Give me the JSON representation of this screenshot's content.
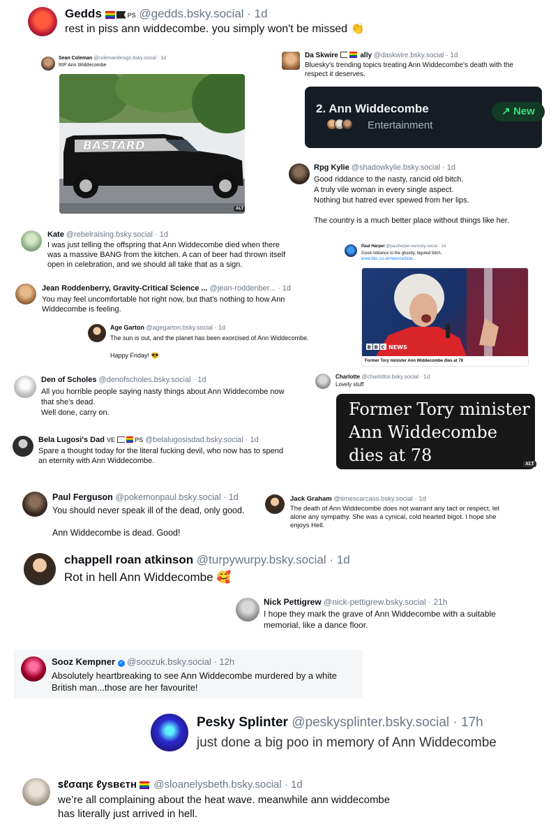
{
  "posts": {
    "gedds": {
      "name": "Gedds",
      "handle": "@gedds.bsky.social · 1d",
      "text": "rest in piss ann widdecombe. you simply won't be missed 👏"
    },
    "sean": {
      "name": "Sean Coleman",
      "handle": "@colemandesign.bsky.social · 1d",
      "text": "RIP Ann Widdecombe",
      "photo_text": "BASTARD",
      "alt": "ALT"
    },
    "daskwire": {
      "name": "Da Skwire",
      "name_suffix": "ally",
      "handle": "@daskwire.bsky.social · 1d",
      "lines": [
        "Bluesky's trending topics treating Ann Widdecombe's death with the",
        "respect it deserves."
      ]
    },
    "trending": {
      "rank": "2. Ann Widdecombe",
      "category": "Entertainment",
      "badge": "↗ New"
    },
    "rpg": {
      "name": "Rpg Kylie",
      "handle": "@shadowkylie.bsky.social · 1d",
      "lines": [
        "Good riddance to the nasty, rancid old bitch.",
        "A truly vile woman in every single aspect.",
        "Nothing but hatred ever spewed from her lips.",
        "",
        "The country is a much better place without things like her."
      ]
    },
    "kate": {
      "name": "Kate",
      "handle": "@rebelraising.bsky.social · 1d",
      "lines": [
        "I was just telling the offspring that Ann Widdecombe died when there",
        "was a massive BANG from the kitchen. A can of beer had thrown itself",
        "open in celebration, and we should all take that as a sign."
      ]
    },
    "paulh": {
      "name": "Paul Harper",
      "handle": "@paulharper.eurosky.social · 1d",
      "text": "Good riddance to the ghastly, bigoted bitch.",
      "link": "www.bbc.co.uk/news/article...",
      "news_logo": "NEWS",
      "caption": "Former Tory minister Ann Widdecombe dies at 78"
    },
    "jean": {
      "name": "Jean Roddenberry, Gravity-Critical Science ...",
      "handle": "@jean-roddenber... · 1d",
      "lines": [
        "You may feel uncomfortable hot right now, but that's nothing to how Ann",
        "Widdecombe is feeling."
      ]
    },
    "age": {
      "name": "Age Garton",
      "handle": "@agegarton.bsky.social · 1d",
      "lines": [
        "The sun is out, and the planet has been exorcised of Ann Widdecombe.",
        "",
        "Happy Friday! 😎"
      ]
    },
    "den": {
      "name": "Den of Scholes",
      "handle": "@denofscholes.bsky.social · 1d",
      "lines": [
        "All you horrible people saying nasty things about Ann Widdecombe now",
        "that she's dead.",
        "Well done, carry on."
      ]
    },
    "charlotte": {
      "name": "Charlotte",
      "handle": "@charlottor.bsky.social · 1d",
      "text": "Lovely stuff"
    },
    "quote": {
      "lines": [
        "Former Tory minister",
        "Ann Widdecombe",
        "dies at 78"
      ],
      "alt": "ALT"
    },
    "bela": {
      "name": "Bela Lugosi's Dad",
      "tag": "VE",
      "handle": "@belalugosisdad.bsky.social · 1d",
      "lines": [
        "Spare a thought today for the literal fucking devil, who now has to spend",
        "an eternity with Ann Widdecombe."
      ]
    },
    "paulf": {
      "name": "Paul Ferguson",
      "handle": "@pokemonpaul.bsky.social · 1d",
      "lines": [
        "You should never speak ill of the dead, only good.",
        "",
        "Ann Widdecombe is dead. Good!"
      ]
    },
    "jack": {
      "name": "Jack Graham",
      "handle": "@timescarcass.bsky.social · 1d",
      "lines": [
        "The death of Ann Widdecombe does not warrant any tact or respect, let",
        "alone any sympathy.  She was a cynical, cold hearted bigot.  I hope she",
        "enjoys Hell."
      ]
    },
    "chappell": {
      "name": "chappell roan atkinson",
      "handle": "@turpywurpy.bsky.social · 1d",
      "text": "Rot in hell Ann Widdecombe 🥰"
    },
    "nick": {
      "name": "Nick Pettigrew",
      "handle": "@nick-pettigrew.bsky.social · 21h",
      "lines": [
        "I hope they mark the grave of Ann Widdecombe with a suitable",
        "memorial, like a dance floor."
      ]
    },
    "sooz": {
      "name": "Sooz Kempner",
      "handle": "@soozuk.bsky.social · 12h",
      "lines": [
        "Absolutely heartbreaking to see Ann Widdecombe murdered by a white",
        "British man...those are her favourite!"
      ]
    },
    "pesky": {
      "name": "Pesky Splinter",
      "handle": "@peskysplinter.bsky.social · 17h",
      "text": "just done a big poo in memory of Ann Widdecombe"
    },
    "sloane": {
      "name": "ꜱℓσαηε ℓуѕвєтн",
      "handle": "@sloanelysbeth.bsky.social · 1d",
      "lines": [
        "we’re all complaining about the heat wave. meanwhile ann widdecombe",
        "has literally just arrived in hell."
      ]
    }
  }
}
